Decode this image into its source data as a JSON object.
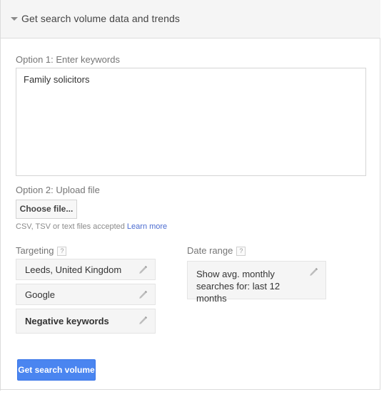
{
  "header": {
    "title": "Get search volume data and trends",
    "collapse_icon": "triangle-down-icon"
  },
  "option1": {
    "label": "Option 1: Enter keywords",
    "keywords_value": "Family solicitors",
    "keywords_placeholder": ""
  },
  "option2": {
    "label": "Option 2: Upload file",
    "choose_file_label": "Choose file...",
    "hint_text": "CSV, TSV or text files accepted",
    "learn_more_label": "Learn more"
  },
  "targeting": {
    "label": "Targeting",
    "help_glyph": "?",
    "rows": [
      {
        "text": "Leeds, United Kingdom",
        "edit_icon": "pencil-icon"
      },
      {
        "text": "Google",
        "edit_icon": "pencil-icon"
      },
      {
        "text": "Negative keywords",
        "edit_icon": "pencil-icon"
      }
    ]
  },
  "date_range": {
    "label": "Date range",
    "help_glyph": "?",
    "value": "Show avg. monthly searches for: last 12 months",
    "edit_icon": "pencil-icon"
  },
  "submit": {
    "label": "Get search volume"
  },
  "colors": {
    "accent_blue": "#4a85f0",
    "link_blue": "#4a6bd0",
    "header_bg": "#f5f5f5",
    "field_bg": "#f5f5f5",
    "border": "#dcdcdc"
  }
}
